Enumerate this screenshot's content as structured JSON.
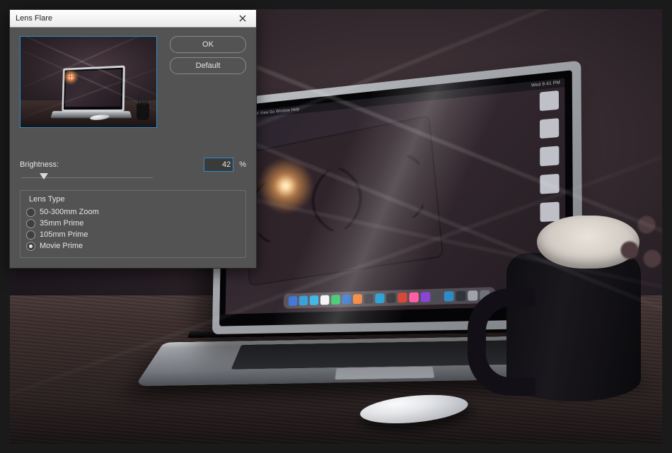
{
  "dialog": {
    "title": "Lens Flare",
    "ok_label": "OK",
    "default_label": "Default",
    "brightness_label": "Brightness:",
    "brightness_value": "42",
    "percent_symbol": "%",
    "lens_type_label": "Lens Type",
    "lens_options": [
      {
        "label": "50-300mm Zoom",
        "selected": false
      },
      {
        "label": "35mm Prime",
        "selected": false
      },
      {
        "label": "105mm Prime",
        "selected": false
      },
      {
        "label": "Movie Prime",
        "selected": true
      }
    ],
    "brightness_slider_pct": 18
  },
  "laptop": {
    "menubar_left": "Finder  File  Edit  View  Go  Window  Help",
    "menubar_right": "Wed 9:41 PM",
    "dock_colors": [
      "#3a74d8",
      "#2d9ad6",
      "#2fb1e2",
      "#f2f2f4",
      "#29c15e",
      "#2568c7",
      "#f07a2a",
      "#3e3e42",
      "#1f9bd1",
      "#333338",
      "#d64433",
      "#ff5fa2",
      "#8a44d6",
      "#4a4e54",
      "#2e8cc4",
      "#30343a",
      "#9fa3a9",
      "#6f7379"
    ],
    "right_icons": [
      "drive",
      "folder",
      "folder",
      "folder",
      "folder",
      "app",
      "doc",
      "trash"
    ]
  }
}
